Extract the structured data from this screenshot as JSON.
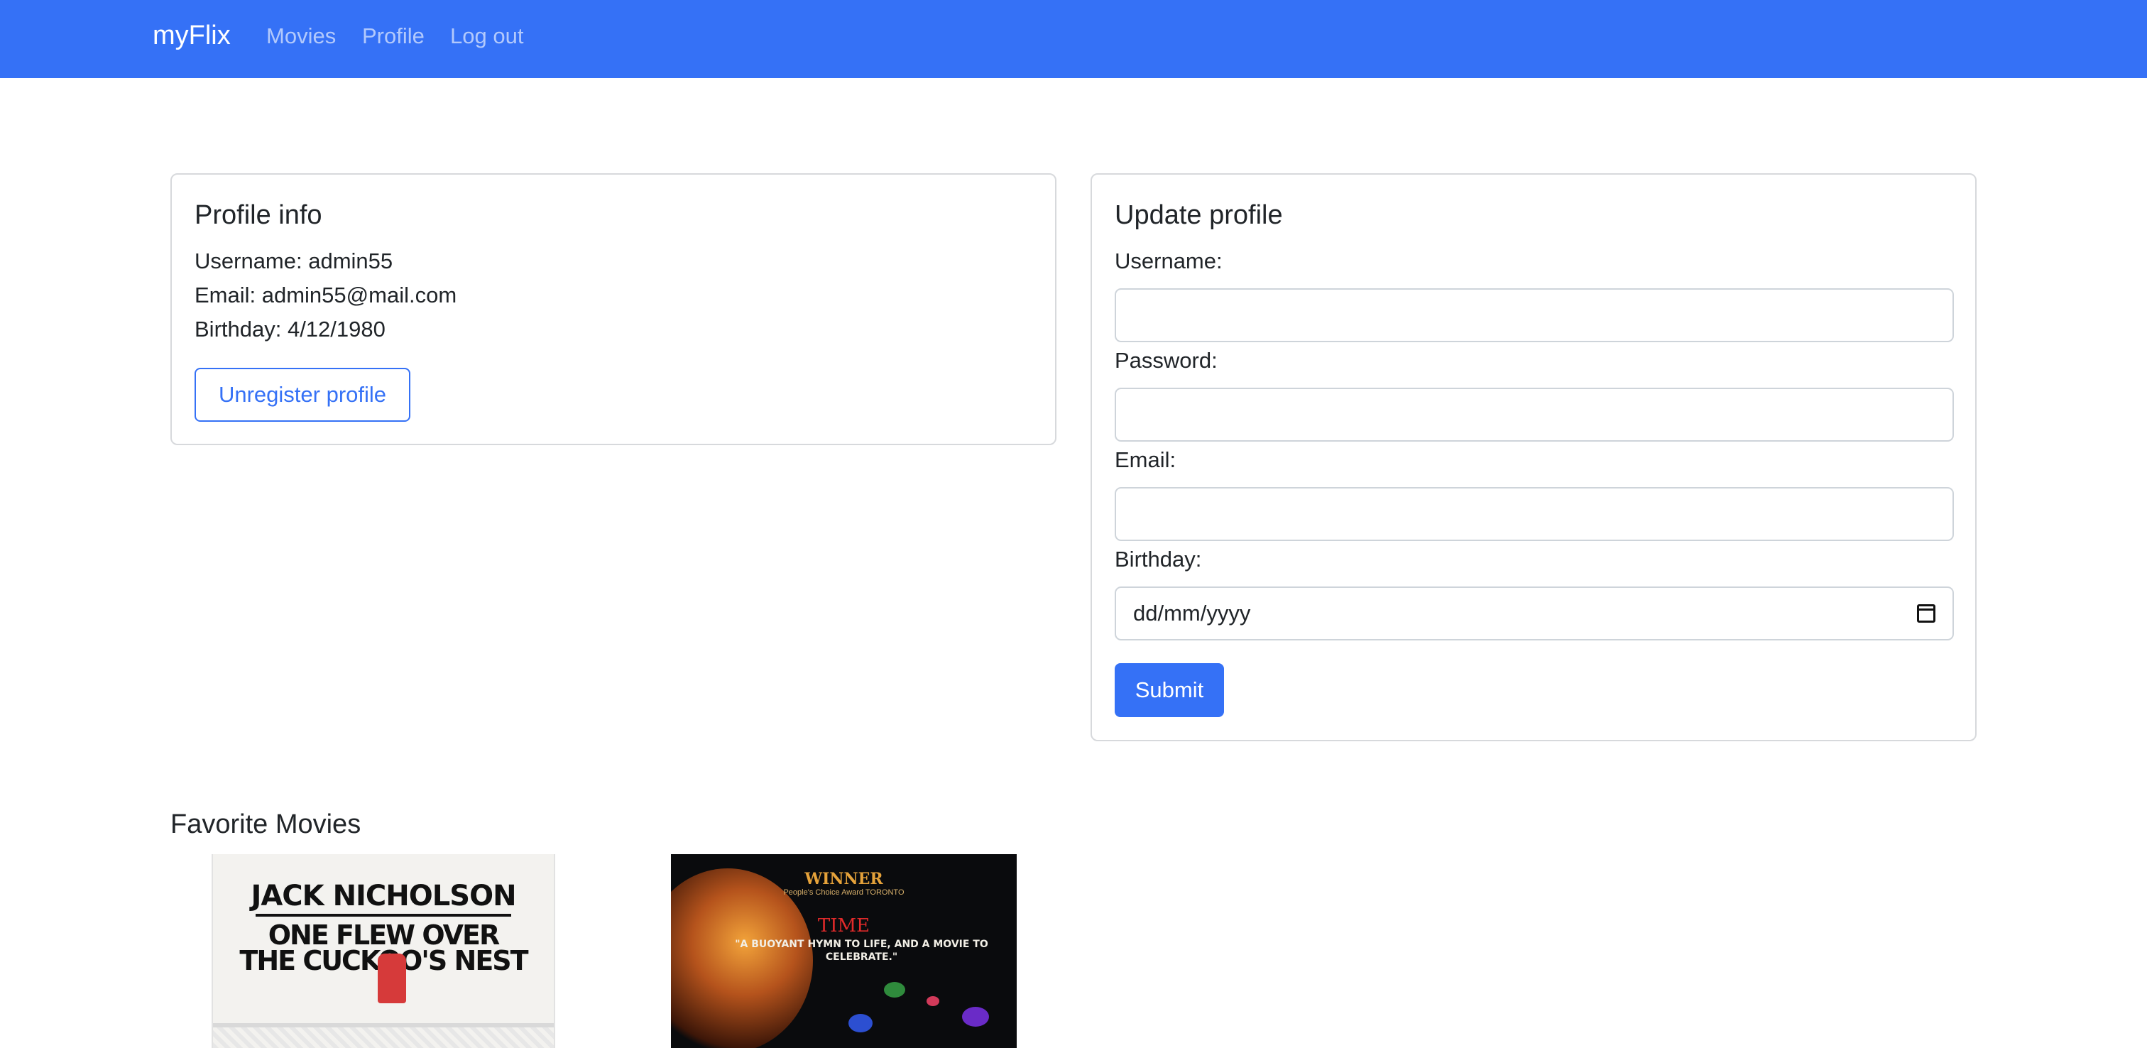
{
  "nav": {
    "brand": "myFlix",
    "links": [
      {
        "label": "Movies"
      },
      {
        "label": "Profile"
      },
      {
        "label": "Log out"
      }
    ]
  },
  "profile_info": {
    "title": "Profile info",
    "username_line": "Username: admin55",
    "email_line": "Email: admin55@mail.com",
    "birthday_line": "Birthday: 4/12/1980",
    "unregister_label": "Unregister profile"
  },
  "update_profile": {
    "title": "Update profile",
    "username_label": "Username:",
    "username_value": "",
    "password_label": "Password:",
    "password_value": "",
    "email_label": "Email:",
    "email_value": "",
    "birthday_label": "Birthday:",
    "birthday_placeholder": "dd/mm/yyyy",
    "submit_label": "Submit"
  },
  "favorites": {
    "title": "Favorite Movies",
    "posters": [
      {
        "line1": "JACK NICHOLSON",
        "line2": "ONE FLEW OVER",
        "line3": "THE CUCKOO'S NEST"
      },
      {
        "award": "WINNER",
        "award_sub": "People's Choice Award TORONTO",
        "publication": "TIME",
        "quote": "\"A BUOYANT HYMN TO LIFE, AND A MOVIE TO CELEBRATE.\""
      }
    ]
  },
  "colors": {
    "primary": "#3571f6",
    "text": "#212529",
    "border": "#d7d9dc"
  }
}
